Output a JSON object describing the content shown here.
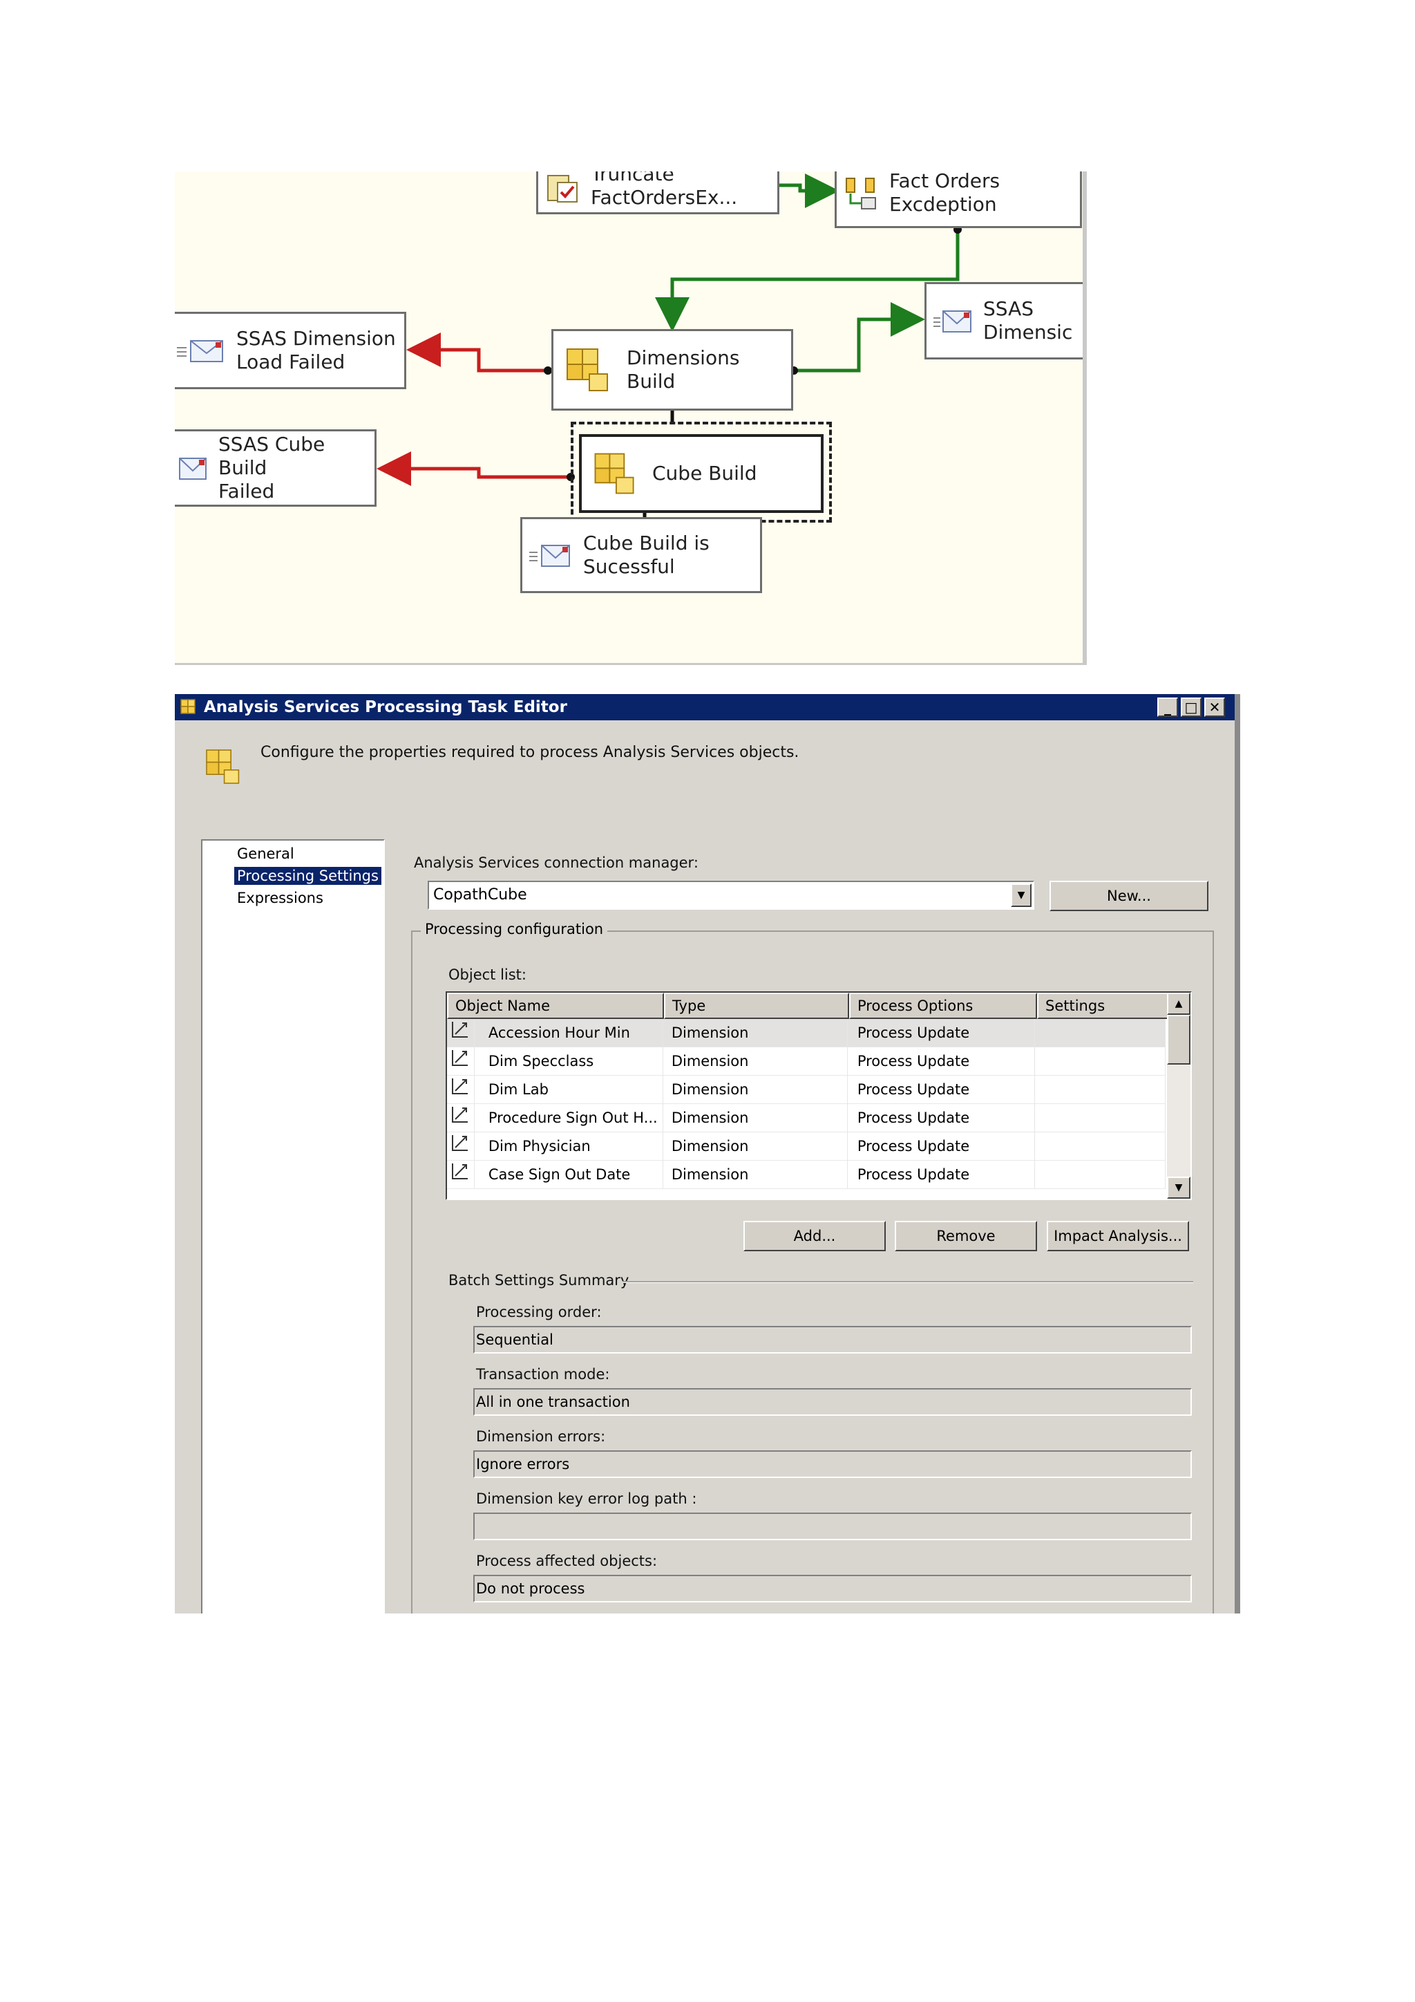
{
  "designer": {
    "tasks": {
      "truncate": {
        "label": "Truncate\nFactOrdersEx..."
      },
      "fact_orders": {
        "label": "Fact Orders\nExcdeption"
      },
      "ssas_dimension_top": {
        "label": "SSAS\nDimensic"
      },
      "ssas_dimension_failed": {
        "label": "SSAS Dimension\nLoad Failed"
      },
      "dimensions_build": {
        "label": "Dimensions Build"
      },
      "ssas_cube_failed": {
        "label": "SSAS Cube Build\nFailed"
      },
      "cube_build": {
        "label": "Cube Build"
      },
      "cube_success": {
        "label": "Cube Build is\nSucessful"
      }
    },
    "colors": {
      "success": "#1e7d1e",
      "failure": "#c81e1e",
      "background": "#fffdf0"
    }
  },
  "dialog": {
    "title": "Analysis Services Processing Task Editor",
    "title_buttons": {
      "minimize": "_",
      "maximize": "□",
      "close": "✕"
    },
    "description": "Configure the properties required to process Analysis Services objects.",
    "nav": {
      "items": [
        {
          "label": "General",
          "selected": false
        },
        {
          "label": "Processing Settings",
          "selected": true
        },
        {
          "label": "Expressions",
          "selected": false
        }
      ]
    },
    "connection": {
      "label": "Analysis Services connection manager:",
      "value": "CopathCube",
      "new_button": "New..."
    },
    "processing_config": {
      "title": "Processing configuration",
      "object_list_label": "Object list:",
      "columns": [
        "Object Name",
        "Type",
        "Process Options",
        "Settings"
      ],
      "rows": [
        {
          "name": "Accession Hour Min",
          "type": "Dimension",
          "process": "Process Update",
          "settings": ""
        },
        {
          "name": "Dim Specclass",
          "type": "Dimension",
          "process": "Process Update",
          "settings": ""
        },
        {
          "name": "Dim Lab",
          "type": "Dimension",
          "process": "Process Update",
          "settings": ""
        },
        {
          "name": "Procedure Sign Out H...",
          "type": "Dimension",
          "process": "Process Update",
          "settings": ""
        },
        {
          "name": "Dim Physician",
          "type": "Dimension",
          "process": "Process Update",
          "settings": ""
        },
        {
          "name": "Case Sign Out Date",
          "type": "Dimension",
          "process": "Process Update",
          "settings": ""
        }
      ],
      "buttons": {
        "add": "Add...",
        "remove": "Remove",
        "impact": "Impact Analysis..."
      }
    },
    "batch": {
      "title": "Batch Settings Summary",
      "processing_order_label": "Processing order:",
      "processing_order": "Sequential",
      "transaction_mode_label": "Transaction mode:",
      "transaction_mode": "All in one transaction",
      "dimension_errors_label": "Dimension errors:",
      "dimension_errors": "Ignore errors",
      "key_error_log_label": "Dimension key error log path :",
      "key_error_log": "",
      "process_affected_label": "Process affected objects:",
      "process_affected": "Do not process"
    },
    "colors": {
      "titlebar": "#0a246a",
      "face": "#d9d6d0",
      "selection": "#0a246a"
    }
  }
}
